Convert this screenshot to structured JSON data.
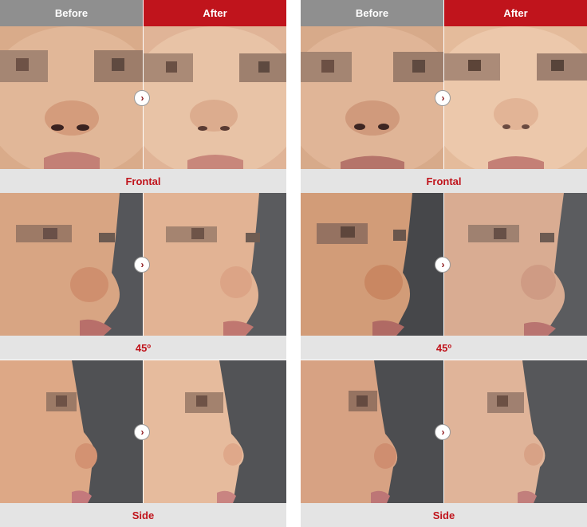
{
  "header": {
    "before": "Before",
    "after": "After"
  },
  "labels": {
    "frontal": "Frontal",
    "angle": "45º",
    "side": "Side"
  },
  "icons": {
    "arrow": "chevron-right-icon"
  },
  "colors": {
    "accent": "#c0141c",
    "before_bg": "#8f8f8f",
    "label_bg": "#e4e4e4"
  }
}
